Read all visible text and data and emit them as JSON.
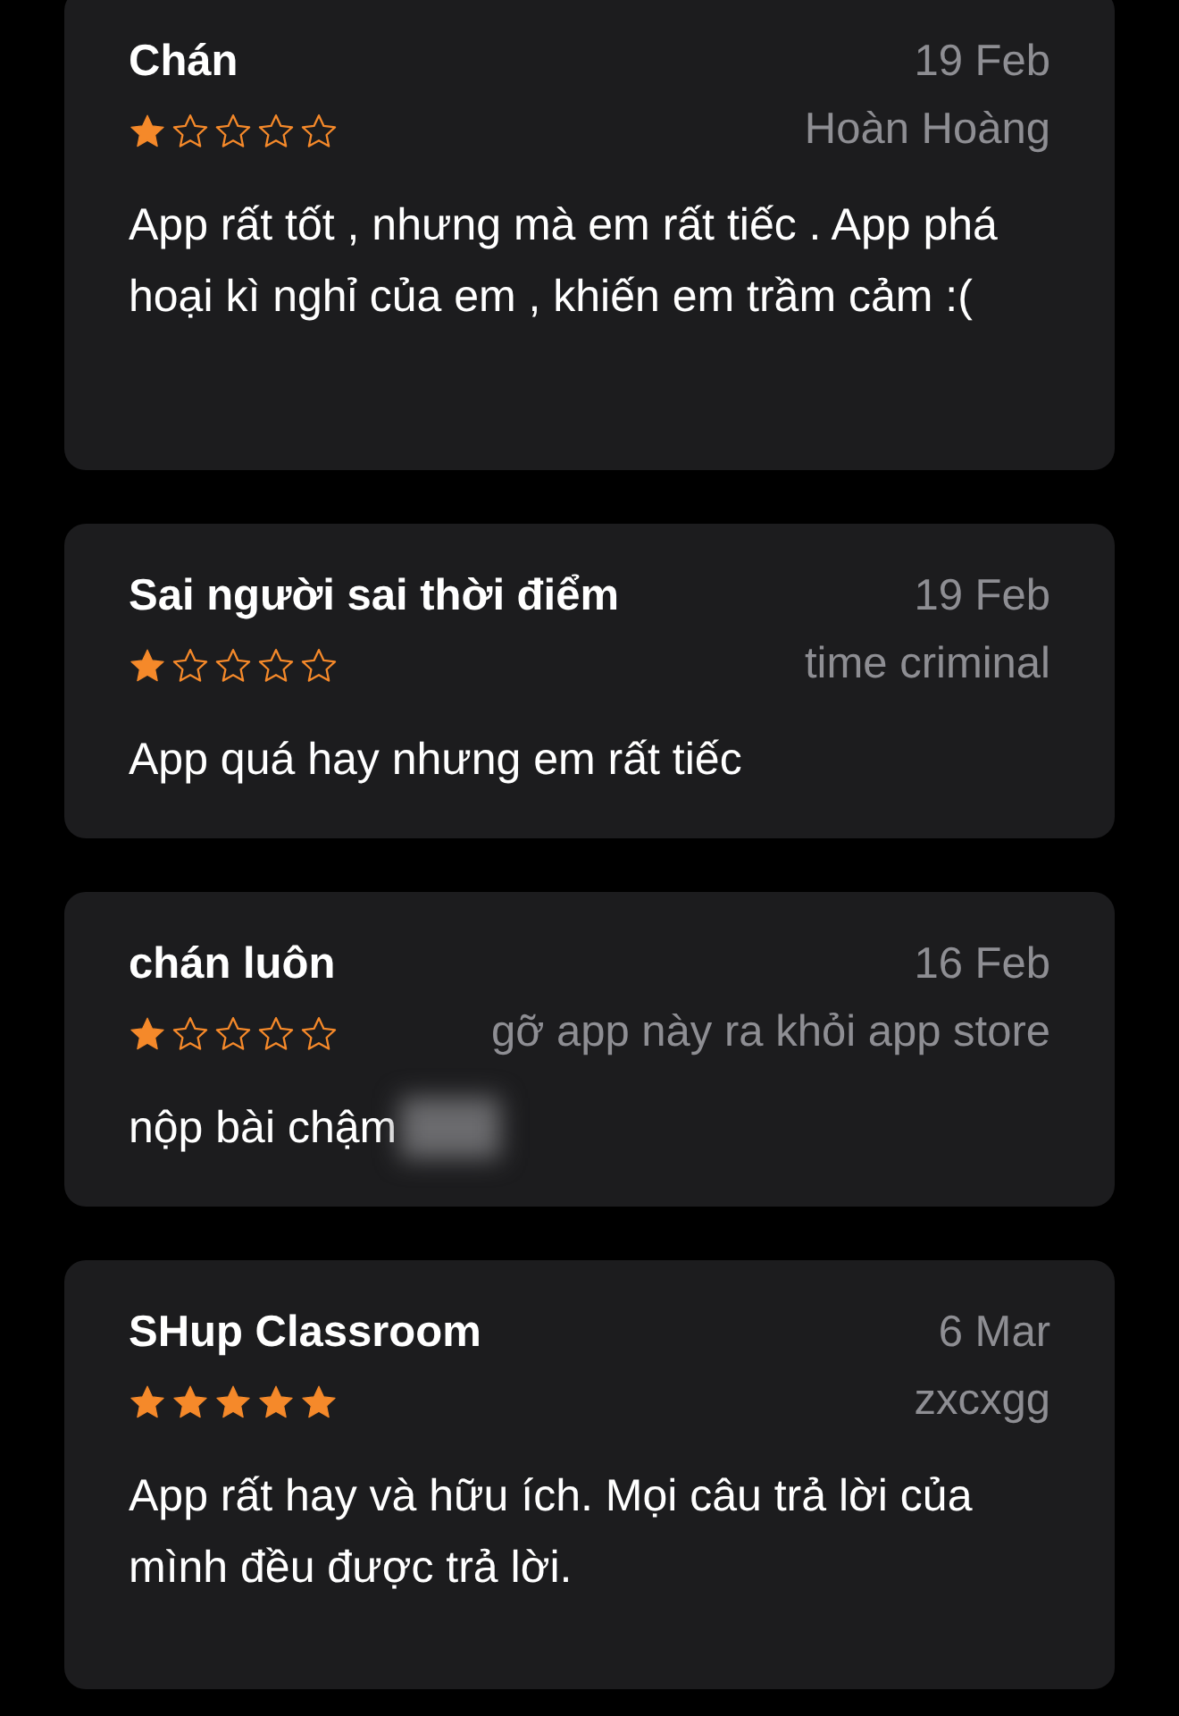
{
  "reviews": [
    {
      "title": "Chán",
      "date": "19 Feb",
      "stars": 1,
      "author": "Hoàn Hoàng",
      "body": "App rất tốt , nhưng mà em rất tiếc . App phá hoại kì nghỉ của em , khiến em trầm cảm :(",
      "blurred": false
    },
    {
      "title": "Sai người sai thời điểm",
      "date": "19 Feb",
      "stars": 1,
      "author": "time criminal",
      "body": "App quá hay nhưng em rất tiếc",
      "blurred": false
    },
    {
      "title": "chán luôn",
      "date": "16 Feb",
      "stars": 1,
      "author": "gỡ app này ra khỏi app store",
      "body": "nộp bài chậm",
      "blurred": true
    },
    {
      "title": "SHup Classroom",
      "date": "6 Mar",
      "stars": 5,
      "author": "zxcxgg",
      "body": "App rất hay và hữu ích. Mọi câu trả lời của mình đều được trả lời.",
      "blurred": false
    }
  ]
}
